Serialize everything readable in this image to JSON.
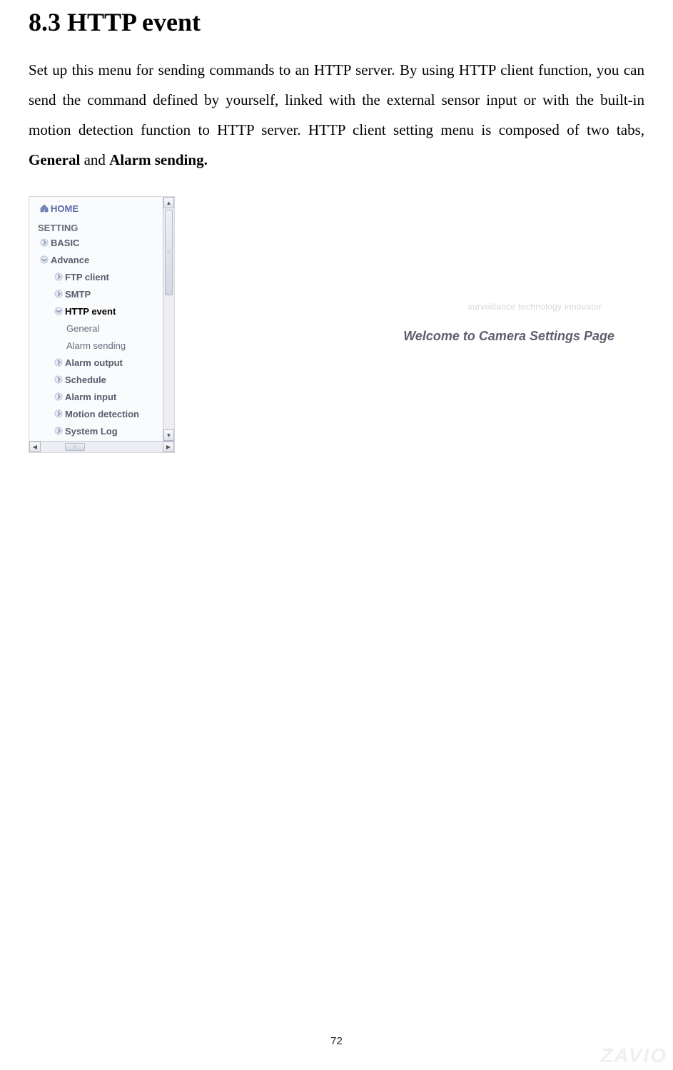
{
  "heading": "8.3 HTTP event",
  "paragraph_plain": "Set up this menu for sending commands to an HTTP server. By using HTTP client function, you can send the command defined by yourself, linked with the external sensor input or with the built-in motion detection function to HTTP server. HTTP client setting menu is composed of two tabs, ",
  "paragraph_bold_general": "General",
  "paragraph_mid": " and ",
  "paragraph_bold_alarm": "Alarm sending.",
  "sidebar": {
    "home": "HOME",
    "setting_header": "SETTING",
    "items": [
      {
        "label": "BASIC"
      },
      {
        "label": "Advance"
      },
      {
        "label": "FTP client"
      },
      {
        "label": "SMTP"
      },
      {
        "label": "HTTP event"
      },
      {
        "label": "General"
      },
      {
        "label": "Alarm sending"
      },
      {
        "label": "Alarm output"
      },
      {
        "label": "Schedule"
      },
      {
        "label": "Alarm input"
      },
      {
        "label": "Motion detection"
      },
      {
        "label": "System Log"
      }
    ]
  },
  "content": {
    "tagline": "surveillance technology innovator",
    "welcome": "Welcome to Camera Settings Page"
  },
  "page_number": "72",
  "watermark": "ZAVIO"
}
